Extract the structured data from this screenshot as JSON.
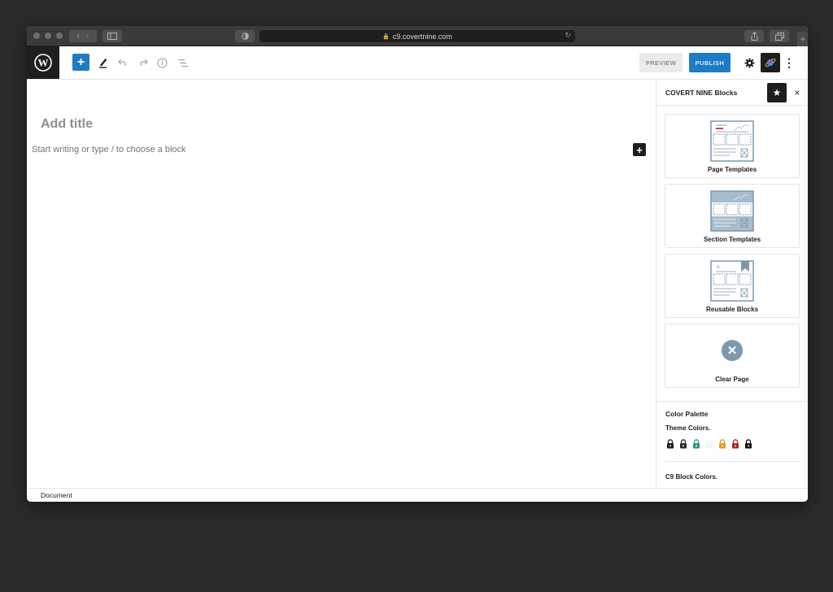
{
  "browser": {
    "url": "c9.covertnine.com"
  },
  "toolbar": {
    "add_label": "+",
    "preview_label": "PREVIEW",
    "publish_label": "PUBLISH",
    "more_label": "⋮"
  },
  "editor": {
    "title_placeholder": "Add title",
    "body_placeholder": "Start writing or type / to choose a block",
    "inline_add_label": "+"
  },
  "sidebar": {
    "title": "COVERT NINE Blocks",
    "close_label": "×",
    "cards": [
      {
        "label": "Page Templates",
        "icon": "page-templates-icon"
      },
      {
        "label": "Section Templates",
        "icon": "section-templates-icon"
      },
      {
        "label": "Reusable Blocks",
        "icon": "reusable-blocks-icon"
      },
      {
        "label": "Clear Page",
        "icon": "clear-page-icon"
      }
    ],
    "palette": {
      "title": "Color Palette",
      "theme_label": "Theme Colors.",
      "theme_colors": [
        "#1e1e1e",
        "#2c2c2c",
        "#2e9e6d",
        "#f3f3f3",
        "#e39a2b",
        "#9b2a2a",
        "#111111"
      ],
      "block_label": "C9 Block Colors."
    }
  },
  "footer": {
    "breadcrumb": "Document"
  },
  "colors": {
    "accent": "#1e7cc4",
    "dark": "#1e1e1e",
    "icon_blue": "#7c98ad"
  }
}
